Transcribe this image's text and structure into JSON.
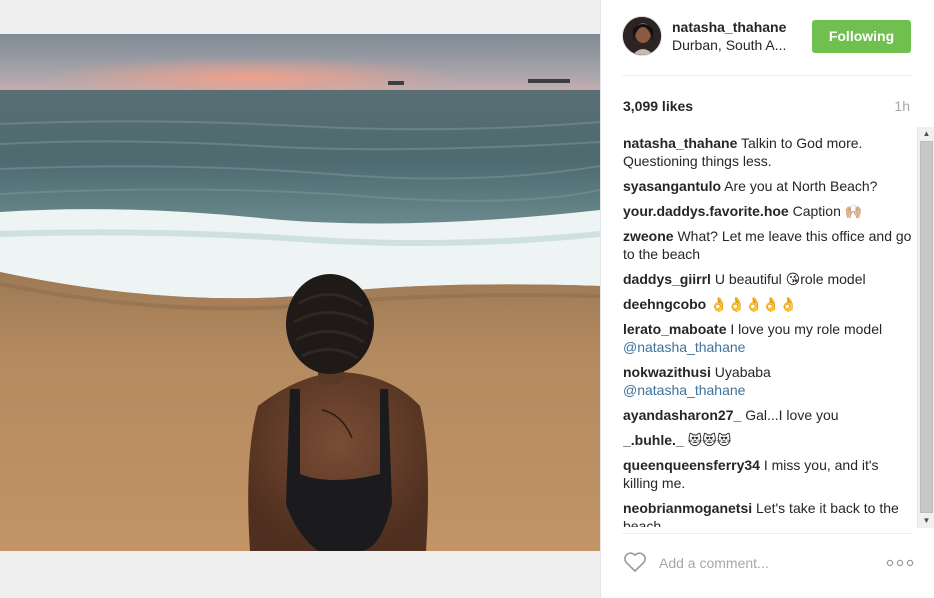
{
  "post": {
    "username": "natasha_thahane",
    "location": "Durban, South A...",
    "follow_label": "Following",
    "likes": "3,099 likes",
    "time": "1h"
  },
  "comments": [
    {
      "user": "natasha_thahane",
      "text": "Talkin to God more. Questioning things less.",
      "mention": ""
    },
    {
      "user": "syasangantulo",
      "text": "Are you at North Beach?",
      "mention": ""
    },
    {
      "user": "your.daddys.favorite.hoe",
      "text": "Caption 🙌🏼",
      "mention": ""
    },
    {
      "user": "zweone",
      "text": "What? Let me leave this office and go to the beach",
      "mention": ""
    },
    {
      "user": "daddys_giirrl",
      "text": "U beautiful 😘role model",
      "mention": ""
    },
    {
      "user": "deehngcobo",
      "text": "👌👌👌👌👌",
      "mention": ""
    },
    {
      "user": "lerato_maboate",
      "text": "I love you my role model",
      "mention": "@natasha_thahane"
    },
    {
      "user": "nokwazithusi",
      "text": "Uyababa",
      "mention": "@natasha_thahane"
    },
    {
      "user": "ayandasharon27_",
      "text": "Gal...I love you",
      "mention": ""
    },
    {
      "user": "_.buhle._",
      "text": "😻😻😻",
      "mention": ""
    },
    {
      "user": "queenqueensferry34",
      "text": "I miss you, and it's killing me.",
      "mention": ""
    },
    {
      "user": "neobrianmoganetsi",
      "text": "Let's take it back to the beach",
      "mention": ""
    }
  ],
  "comment_box": {
    "placeholder": "Add a comment..."
  },
  "icons": {
    "like": "heart-outline-icon",
    "more": "more-options-icon"
  },
  "colors": {
    "follow_button": "#70c050",
    "mention": "#3f729b"
  }
}
